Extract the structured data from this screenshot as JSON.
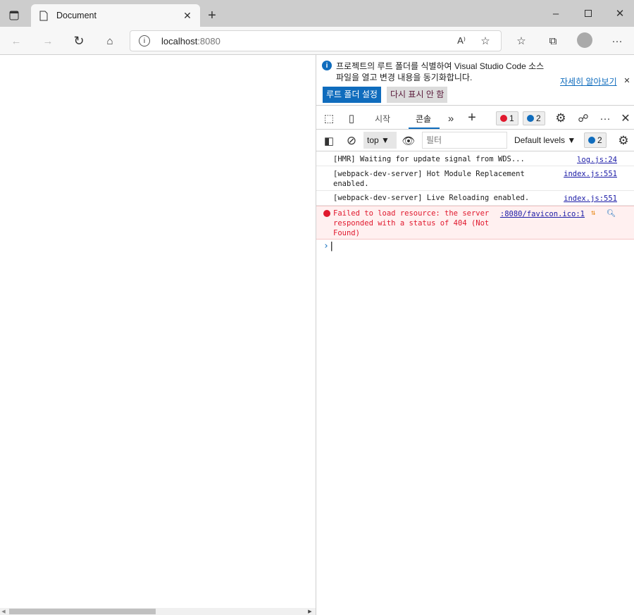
{
  "browser": {
    "tab_title": "Document",
    "url_host": "localhost",
    "url_port": ":8080"
  },
  "devtools": {
    "infobar": {
      "line1": "프로젝트의 루트 폴더를 식별하여 Visual Studio Code 소스",
      "line2": "파일을 열고 변경 내용을 동기화합니다.",
      "learn_more": "자세히 알아보기",
      "primary_button": "루트 폴더 설정",
      "secondary_button": "다시 표시 안 함"
    },
    "tabs": [
      {
        "label": "시작",
        "active": false
      },
      {
        "label": "콘솔",
        "active": true
      }
    ],
    "error_count": "1",
    "info_count": "2",
    "console_toolbar": {
      "context": "top",
      "filter_placeholder": "필터",
      "levels": "Default levels",
      "issues_count": "2"
    },
    "messages": [
      {
        "text": "[HMR] Waiting for update signal from WDS...",
        "source": "log.js:24",
        "level": "log"
      },
      {
        "text": "[webpack-dev-server] Hot Module Replacement enabled.",
        "source": "index.js:551",
        "level": "log"
      },
      {
        "text": "[webpack-dev-server] Live Reloading enabled.",
        "source": "index.js:551",
        "level": "log"
      },
      {
        "text": "Failed to load resource: the server responded with a status of 404 (Not Found)",
        "source": ":8080/favicon.ico:1",
        "level": "error"
      }
    ],
    "colors": {
      "accent": "#0f6cbd",
      "error_bg": "#fff0f0",
      "error_text": "#e0182d"
    }
  }
}
